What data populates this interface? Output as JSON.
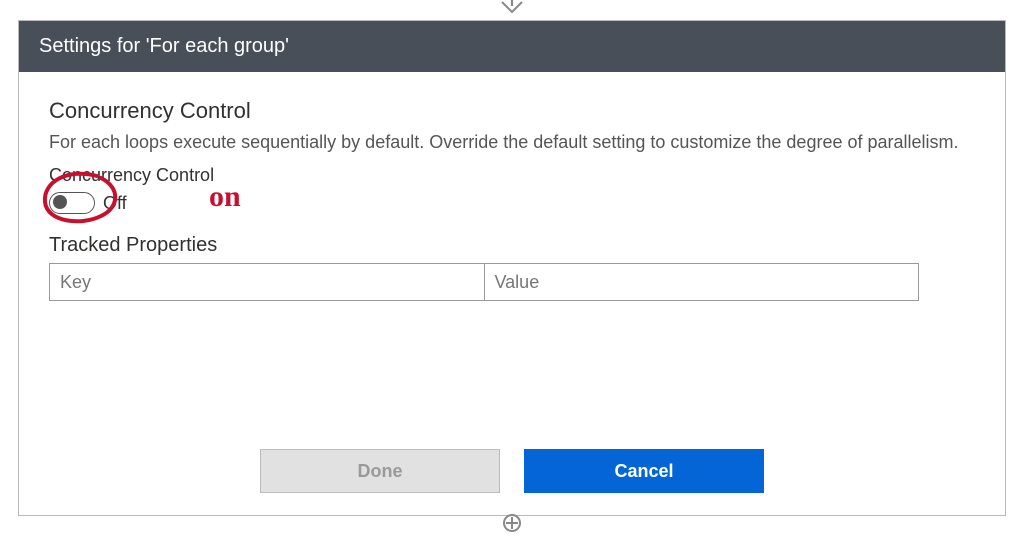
{
  "header": {
    "title": "Settings for 'For each group'"
  },
  "concurrency": {
    "title": "Concurrency Control",
    "description": "For each loops execute sequentially by default. Override the default setting to customize the degree of parallelism.",
    "toggle_label": "Concurrency Control",
    "toggle_state": "Off"
  },
  "tracked": {
    "title": "Tracked Properties",
    "key_header": "Key",
    "value_header": "Value"
  },
  "footer": {
    "done_label": "Done",
    "cancel_label": "Cancel"
  },
  "annotation": {
    "text": "on"
  }
}
